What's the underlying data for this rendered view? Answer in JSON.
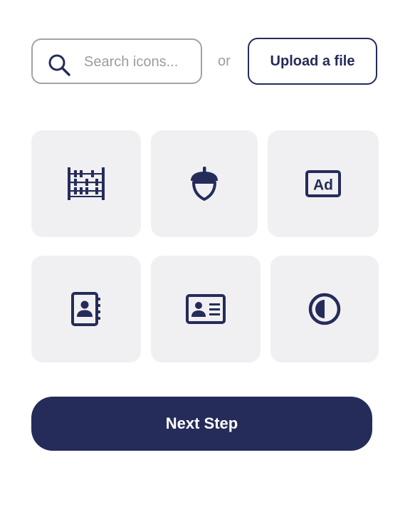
{
  "search": {
    "placeholder": "Search icons...",
    "value": "",
    "icon": "search-icon"
  },
  "or_label": "or",
  "upload_label": "Upload a file",
  "icons": [
    {
      "name": "abacus-icon"
    },
    {
      "name": "acorn-icon"
    },
    {
      "name": "ad-icon",
      "text": "Ad"
    },
    {
      "name": "address-book-icon"
    },
    {
      "name": "address-card-icon"
    },
    {
      "name": "adjust-icon"
    }
  ],
  "next_label": "Next Step",
  "colors": {
    "primary": "#252c5a",
    "tile_bg": "#f0f0f2",
    "muted": "#9c9ca2",
    "border": "#a3a3a6"
  }
}
